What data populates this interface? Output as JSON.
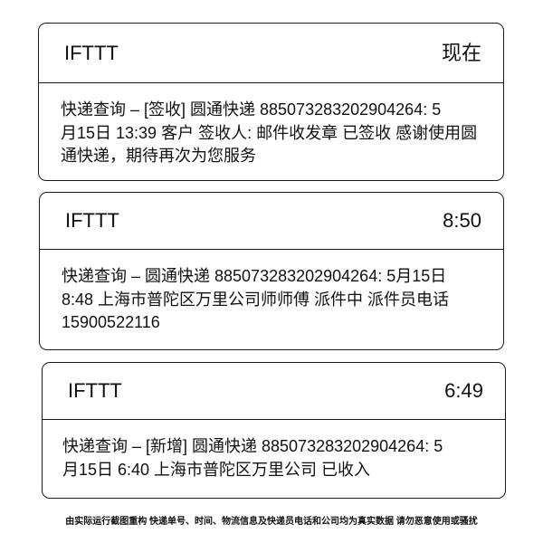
{
  "notifications": [
    {
      "app": "IFTTT",
      "time": "现在",
      "message_lines": [
        "快递查询 – [签收] 圆通快递 885073283202904264: 5",
        "月15日 13:39 客户 签收人: 邮件收发章 已签收 感谢使用圆",
        "通快递，期待再次为您服务"
      ]
    },
    {
      "app": "IFTTT",
      "time": "8:50",
      "message_lines": [
        "快递查询 – 圆通快递 885073283202904264: 5月15日",
        "8:48 上海市普陀区万里公司师师傅 派件中 派件员电话",
        "15900522116"
      ]
    },
    {
      "app": "IFTTT",
      "time": "6:49",
      "message_lines": [
        "快递查询 – [新增] 圆通快递 885073283202904264: 5",
        "月15日 6:40 上海市普陀区万里公司 已收入"
      ]
    }
  ],
  "footer": "由实际运行截图重构 快递单号、时间、物流信息及快递员电话和公司均为真实数据 请勿恶意使用或骚扰",
  "colors": {
    "background": "#ffffff",
    "border": "#1a1a1a",
    "text": "#111111"
  }
}
